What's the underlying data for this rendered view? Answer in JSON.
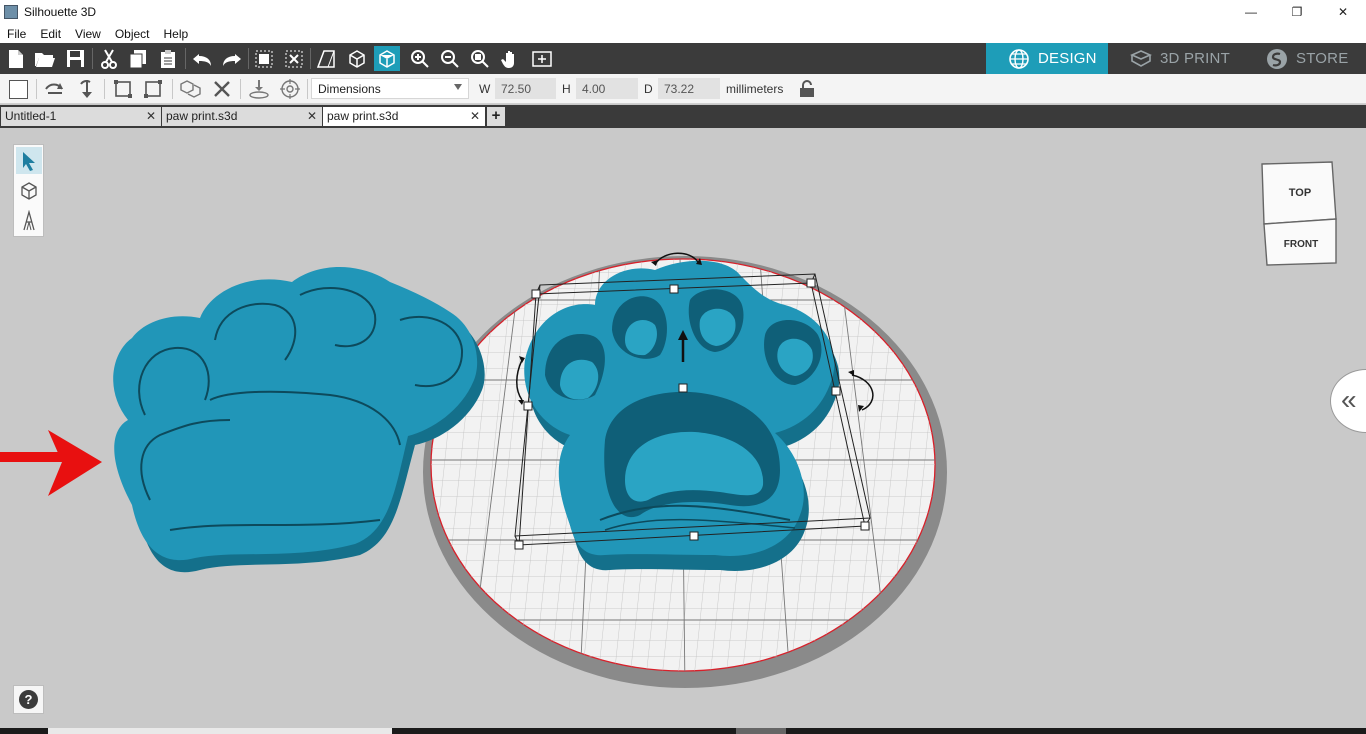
{
  "window": {
    "title": "Silhouette 3D",
    "controls": [
      "—",
      "❐",
      "✕"
    ]
  },
  "menu": [
    "File",
    "Edit",
    "View",
    "Object",
    "Help"
  ],
  "mode_tabs": [
    {
      "label": "DESIGN",
      "icon": "globe-icon",
      "active": true
    },
    {
      "label": "3D PRINT",
      "icon": "printer-icon",
      "active": false
    },
    {
      "label": "STORE",
      "icon": "store-icon",
      "active": false
    }
  ],
  "toolbar_icons": [
    "new-file-icon",
    "open-folder-icon",
    "save-icon",
    "cut-icon",
    "copy-icon",
    "paste-icon",
    "undo-icon",
    "redo-icon",
    "group-icon",
    "ungroup-icon",
    "perspective-icon",
    "wireframe-view-icon",
    "solid-view-icon",
    "zoom-in-icon",
    "zoom-out-icon",
    "zoom-fit-icon",
    "pan-hand-icon",
    "fit-page-icon"
  ],
  "properties": {
    "select_value": "Dimensions",
    "w_label": "W",
    "w_value": "72.50",
    "h_label": "H",
    "h_value": "4.00",
    "d_label": "D",
    "d_value": "73.22",
    "units": "millimeters"
  },
  "doc_tabs": [
    {
      "label": "Untitled-1",
      "active": false
    },
    {
      "label": "paw print.s3d",
      "active": false
    },
    {
      "label": "paw print.s3d",
      "active": true
    }
  ],
  "view_cube": {
    "top": "TOP",
    "front": "FRONT"
  },
  "colors": {
    "accent": "#1e9db8",
    "paw_blue": "#2196b8",
    "arrow_red": "#e81010",
    "bed_red_line": "#d8202a"
  }
}
